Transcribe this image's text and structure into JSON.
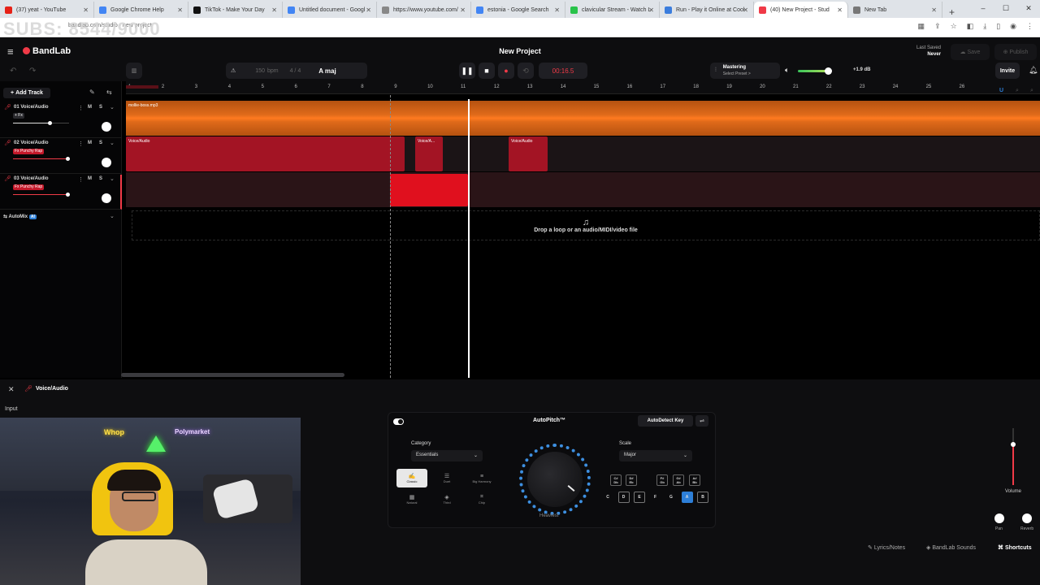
{
  "browser": {
    "tabs": [
      {
        "title": "(37) yeat - YouTube",
        "color": "#e62117"
      },
      {
        "title": "Google Chrome Help",
        "color": "#4285f4"
      },
      {
        "title": "TikTok - Make Your Day",
        "color": "#111111"
      },
      {
        "title": "Untitled document - Googl",
        "color": "#4285f4"
      },
      {
        "title": "https://www.youtube.com/",
        "color": "#888888"
      },
      {
        "title": "estonia - Google Search",
        "color": "#4285f4"
      },
      {
        "title": "clavicular Stream - Watch L",
        "color": "#29c34a"
      },
      {
        "title": "Run - Play it Online at Cool",
        "color": "#3b7ddd"
      },
      {
        "title": "(40) New Project - Stud",
        "color": "#f03a47",
        "active": true
      },
      {
        "title": "New Tab",
        "color": "#777777"
      }
    ],
    "new_tab": "+",
    "url": "bandlab.com/studio · new project",
    "overlay_text": "SUBS: 8544/9000"
  },
  "app": {
    "brand": "BandLab",
    "project_title": "New Project",
    "last_saved_label": "Last Saved",
    "last_saved_value": "Never",
    "save_label": "Save",
    "publish_label": "Publish",
    "invite_label": "Invite",
    "bpm_value": "150",
    "bpm_unit": "bpm",
    "time_sig": "4 / 4",
    "key": "A maj",
    "time": "00:16.5",
    "mastering_label": "Mastering",
    "mastering_preset": "Select Preset >",
    "volume_db": "+1.9 dB",
    "add_track": "Add Track",
    "accent": "#f03a47"
  },
  "ruler": [
    "1",
    "2",
    "3",
    "4",
    "5",
    "6",
    "7",
    "8",
    "9",
    "10",
    "11",
    "12",
    "13",
    "14",
    "15",
    "16",
    "17",
    "18",
    "19",
    "20",
    "21",
    "22",
    "23",
    "24",
    "25",
    "26"
  ],
  "tracks": [
    {
      "name": "01  Voice/Audio",
      "fx": "+ Fx",
      "fx_color": "#2a2a2e",
      "slider": 0.65
    },
    {
      "name": "02  Voice/Audio",
      "fx": "Fx Punchy Rap",
      "fx_color": "#c4192a",
      "slider": 0.97
    },
    {
      "name": "03  Voice/Audio",
      "fx": "Fx Punchy Rap",
      "fx_color": "#c4192a",
      "slider": 0.97
    }
  ],
  "automix": {
    "label": "AutoMix",
    "badge": "AI"
  },
  "clips": {
    "track1_label": "mollie-boss.mp3",
    "track2_labels": [
      "Voice/Audio",
      "Voice/A...",
      "Voice/Audio"
    ]
  },
  "drop_text": "Drop a loop or an audio/MIDI/video file",
  "panel": {
    "title": "Voice/Audio",
    "input_label": "Input",
    "autopitch": "AutoPitch™",
    "autodetect": "AutoDetect Key",
    "category_label": "Category",
    "category_value": "Essentials",
    "categories": [
      "Classic",
      "Duet",
      "Big Harmony",
      "Natural",
      "Third",
      "Chip"
    ],
    "dial_label": "Heaviest",
    "scale_label": "Scale",
    "scale_value": "Major",
    "sharps": [
      "C#\nDb",
      "D#\nEb",
      "F#\nGb",
      "G#\nAb",
      "A#\nBb"
    ],
    "naturals": [
      "C",
      "D",
      "E",
      "F",
      "G",
      "A",
      "B"
    ],
    "selected_key": "A",
    "volume_label": "Volume",
    "pan_label": "Pan",
    "reverb_label": "Reverb"
  },
  "webcam": {
    "neon1": "Whop",
    "neon2": "Polymarket"
  },
  "footer": {
    "lyrics": "Lyrics/Notes",
    "sounds": "BandLab Sounds",
    "shortcuts": "Shortcuts"
  }
}
